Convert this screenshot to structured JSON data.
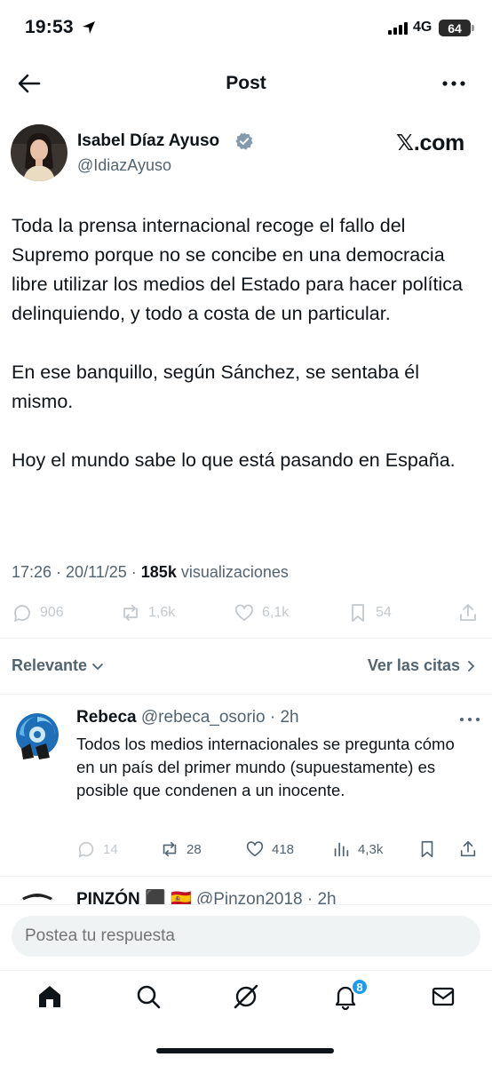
{
  "status_bar": {
    "time": "19:53",
    "network": "4G",
    "battery": "64"
  },
  "header": {
    "title": "Post",
    "back_icon": "arrow-left-icon",
    "more_icon": "more-horizontal-icon"
  },
  "post": {
    "author_name": "Isabel Díaz Ayuso",
    "author_handle": "@IdiazAyuso",
    "source": "𝕏.com",
    "paragraphs": [
      "Toda la prensa internacional recoge el fallo del Supremo porque no se concibe en una democracia libre utilizar los medios del Estado para hacer política delinquiendo, y todo a costa de un particular.",
      "En ese banquillo, según Sánchez, se sentaba él mismo.",
      "Hoy el mundo sabe lo que está pasando en España."
    ],
    "time": "17:26",
    "date": "20/11/25",
    "views_count": "185k",
    "views_label": "visualizaciones",
    "stats": {
      "replies": "906",
      "reposts": "1,6k",
      "likes": "6,1k",
      "bookmarks": "54"
    }
  },
  "sort": {
    "left_label": "Relevante",
    "right_label": "Ver las citas"
  },
  "replies": [
    {
      "name": "Rebeca",
      "handle": "@rebeca_osorio",
      "time": "2h",
      "text": "Todos los medios internacionales se pregunta cómo en un país del primer mundo (supuestamente) es posible que condenen a un inocente.",
      "replies": "14",
      "reposts": "28",
      "likes": "418",
      "views": "4,3k"
    },
    {
      "name": "PINZÓN",
      "flags": "⬛ 🇪🇸",
      "handle": "@Pinzon2018",
      "time": "2h"
    }
  ],
  "compose": {
    "placeholder": "Postea tu respuesta"
  },
  "tab_bar": {
    "notifications_count": "8"
  },
  "colors": {
    "text": "#0f1419",
    "secondary": "#536471",
    "accent": "#1d9bf0",
    "verified": "#829aab"
  }
}
